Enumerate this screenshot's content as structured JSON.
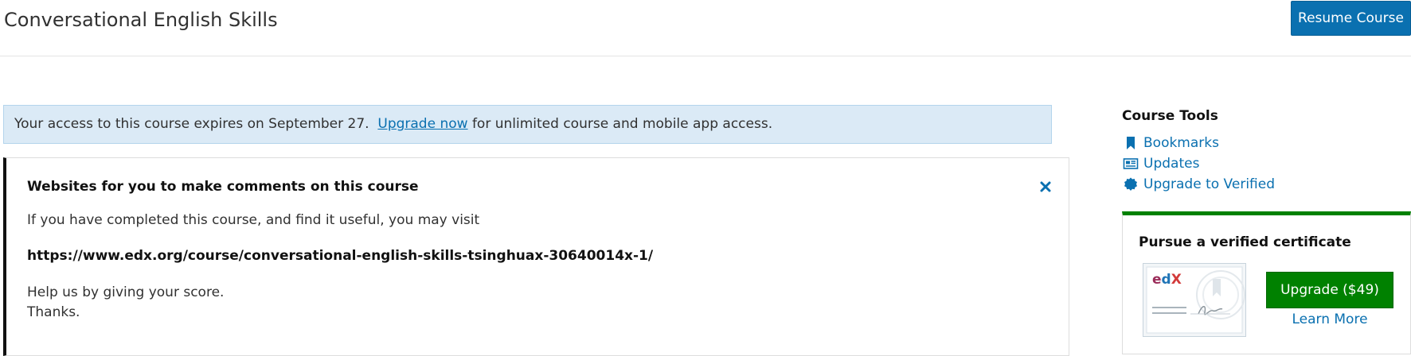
{
  "header": {
    "course_title": "Conversational English Skills",
    "resume_label": "Resume Course"
  },
  "banner": {
    "text_before": "Your access to this course expires on September 27.",
    "link_label": "Upgrade now",
    "text_after": " for unlimited course and mobile app access."
  },
  "notice": {
    "title": "Websites for you to make comments on this course",
    "line1": "If you have completed this course, and find it useful, you may visit",
    "url": "https://www.edx.org/course/conversational-english-skills-tsinghuax-30640014x-1/",
    "line3": "Help us by giving your score.",
    "line4": "Thanks.",
    "close_icon": "close-icon"
  },
  "course_tools": {
    "heading": "Course Tools",
    "items": [
      {
        "label": "Bookmarks",
        "icon": "bookmark-icon"
      },
      {
        "label": "Updates",
        "icon": "newspaper-icon"
      },
      {
        "label": "Upgrade to Verified",
        "icon": "certificate-seal-icon"
      }
    ]
  },
  "certificate": {
    "heading": "Pursue a verified certificate",
    "image_logo_text": "edX",
    "upgrade_label": "Upgrade ($49)",
    "learn_more_label": "Learn More"
  },
  "colors": {
    "accent": "#0a70b0",
    "success": "#008100",
    "banner_bg": "#dbeaf6"
  }
}
